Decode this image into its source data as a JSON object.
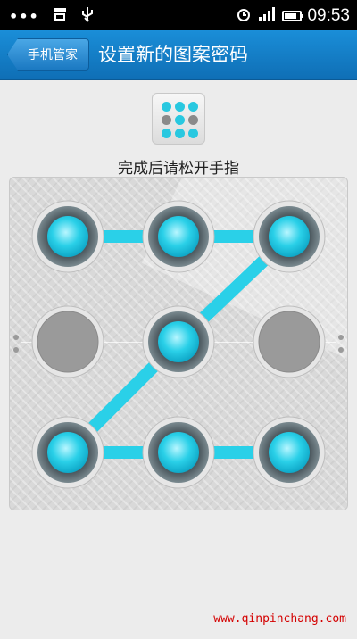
{
  "status_bar": {
    "time": "09:53",
    "left_icons": [
      "dots-icon",
      "storage-icon",
      "usb-icon"
    ],
    "right_icons": [
      "alarm-icon",
      "signal-icon",
      "battery-icon"
    ]
  },
  "header": {
    "back_label": "手机管家",
    "title": "设置新的图案密码"
  },
  "preview_grid": {
    "states": [
      true,
      true,
      true,
      false,
      true,
      false,
      true,
      true,
      true
    ]
  },
  "instruction": "完成后请松开手指",
  "pattern": {
    "nodes": [
      {
        "id": 1,
        "active": true
      },
      {
        "id": 2,
        "active": true
      },
      {
        "id": 3,
        "active": true
      },
      {
        "id": 4,
        "active": false
      },
      {
        "id": 5,
        "active": true
      },
      {
        "id": 6,
        "active": false
      },
      {
        "id": 7,
        "active": true
      },
      {
        "id": 8,
        "active": true
      },
      {
        "id": 9,
        "active": true
      }
    ],
    "path": [
      1,
      2,
      3,
      5,
      7,
      8,
      9
    ]
  },
  "colors": {
    "accent": "#2ad0e8",
    "header": "#1583cc",
    "inactive": "#9a9a9a"
  },
  "watermark": "www.qinpinchang.com"
}
